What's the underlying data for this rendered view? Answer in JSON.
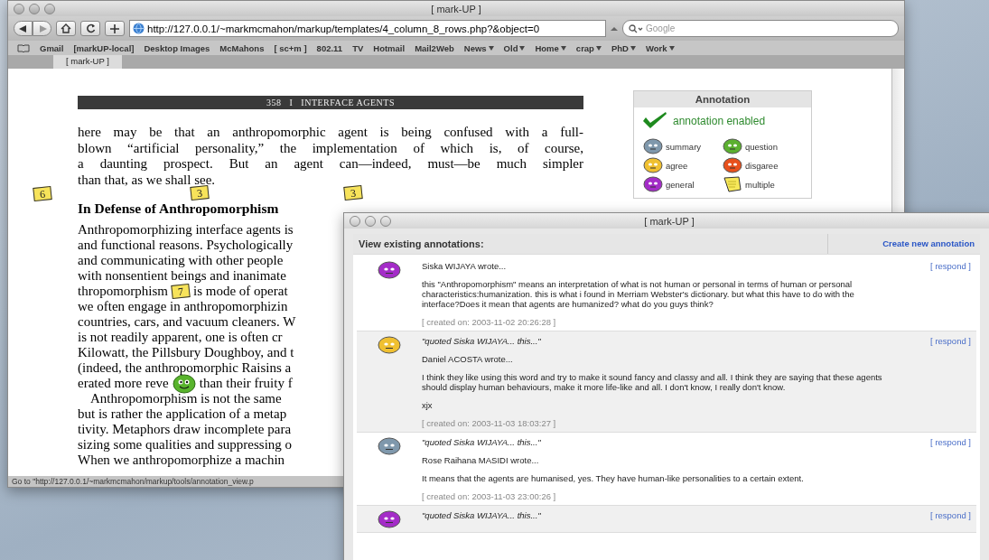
{
  "window": {
    "title": "[ mark-UP ]"
  },
  "toolbar": {
    "url": "http://127.0.0.1/~markmcmahon/markup/templates/4_column_8_rows.php?&object=0",
    "search": {
      "placeholder": "Google"
    }
  },
  "bookmarks": [
    {
      "label": "Gmail",
      "menu": false
    },
    {
      "label": "[markUP-local]",
      "menu": false
    },
    {
      "label": "Desktop Images",
      "menu": false
    },
    {
      "label": "McMahons",
      "menu": false
    },
    {
      "label": "[ sc+m ]",
      "menu": false
    },
    {
      "label": "802.11",
      "menu": false
    },
    {
      "label": "TV",
      "menu": false
    },
    {
      "label": "Hotmail",
      "menu": false
    },
    {
      "label": "Mail2Web",
      "menu": false
    },
    {
      "label": "News",
      "menu": true
    },
    {
      "label": "Old",
      "menu": true
    },
    {
      "label": "Home",
      "menu": true
    },
    {
      "label": "crap",
      "menu": true
    },
    {
      "label": "PhD",
      "menu": true
    },
    {
      "label": "Work",
      "menu": true
    }
  ],
  "tabs": [
    {
      "label": "[ mark-UP ]",
      "selected": true
    }
  ],
  "book": {
    "running_head": "358   I   INTERFACE AGENTS",
    "opening_lines": [
      "here may be that an anthropomorphic agent is being confused with a full-",
      "blown “artificial personality,” the implementation of which is, of course,",
      "a daunting prospect. But an agent can—indeed, must—be much simpler",
      "than that, as we shall see."
    ],
    "notes": [
      {
        "label": "6"
      },
      {
        "label": "3"
      },
      {
        "label": "3"
      }
    ],
    "heading": "In Defense of Anthropomorphism",
    "lines": [
      [
        {
          "kind": "text",
          "text": "Anthropomorphizing interface agents is"
        }
      ],
      [
        {
          "kind": "text",
          "text": "and functional reasons. Psychologically"
        }
      ],
      [
        {
          "kind": "text",
          "text": "and communicating with other people"
        }
      ],
      [
        {
          "kind": "text",
          "text": "with nonsentient beings and inanimate"
        }
      ],
      [
        {
          "kind": "text",
          "text": "thropomorphism"
        },
        {
          "kind": "note",
          "label": "7"
        },
        {
          "kind": "text",
          "text": "is mode of operat"
        }
      ],
      [
        {
          "kind": "text",
          "text": "we often engage in anthropomorphizin"
        }
      ],
      [
        {
          "kind": "text",
          "text": "countries, cars, and vacuum cleaners. W"
        }
      ],
      [
        {
          "kind": "text",
          "text": "is not readily apparent, one is often cr"
        }
      ],
      [
        {
          "kind": "text",
          "text": "Kilowatt, the Pillsbury Doughboy, and t"
        }
      ],
      [
        {
          "kind": "text",
          "text": "(indeed, the anthropomorphic Raisins a"
        }
      ],
      [
        {
          "kind": "text",
          "text": "erated more reve"
        },
        {
          "kind": "face",
          "color": "#58b42c"
        },
        {
          "kind": "text",
          "text": "than their fruity f"
        }
      ],
      [
        {
          "kind": "indent",
          "text": "Anthropomorphism is not the same"
        }
      ],
      [
        {
          "kind": "text",
          "text": "but is rather the application of a metap"
        }
      ],
      [
        {
          "kind": "text",
          "text": "tivity. Metaphors draw incomplete para"
        }
      ],
      [
        {
          "kind": "text",
          "text": "sizing some qualities and suppressing o"
        }
      ],
      [
        {
          "kind": "text",
          "text": "When we anthropomorphize a machin"
        }
      ]
    ]
  },
  "annotation_panel": {
    "title": "Annotation",
    "status": "annotation enabled",
    "enabled": true,
    "legend": [
      {
        "kind": "face",
        "label": "summary",
        "color": "#7f98ac"
      },
      {
        "kind": "face",
        "label": "question",
        "color": "#5cb030"
      },
      {
        "kind": "face",
        "label": "agree",
        "color": "#f0c030"
      },
      {
        "kind": "face",
        "label": "disgaree",
        "color": "#e8501c"
      },
      {
        "kind": "face",
        "label": "general",
        "color": "#a42cc8"
      },
      {
        "kind": "note",
        "label": "multiple"
      }
    ]
  },
  "status_bar": "Go to \"http://127.0.0.1/~markmcmahon/markup/tools/annotation_view.p",
  "popup": {
    "title": "[ mark-UP ]",
    "heading": "View existing annotations:",
    "create_link": "Create new annotation",
    "entries": [
      {
        "color": "#a42cc8",
        "author": "Siska WIJAYA wrote...",
        "body": [
          "this \"Anthropomorphism\" means an interpretation of what is not human or personal in terms of human or personal characteristics:humanization. this is what i found in Merriam Webster's dictionary. but what this have to do with the interface?Does it mean that agents are humanized? what do you guys think?"
        ],
        "created": "[ created on:  2003-11-02 20:26:28 ]",
        "respond": "[ respond ]"
      },
      {
        "color": "#f0c030",
        "quote": "\"quoted Siska WIJAYA... this...\"",
        "author": "Daniel ACOSTA wrote...",
        "body": [
          "I think they like using this word and try to make it sound fancy and classy and all. I think they are saying that these agents should display human behaviours, make it more life-like and all. I don't know, I really don't know.",
          "xjx"
        ],
        "created": "[ created on:  2003-11-03 18:03:27 ]",
        "respond": "[ respond ]"
      },
      {
        "color": "#7f98ac",
        "quote": "\"quoted Siska WIJAYA... this...\"",
        "author": "Rose Raihana MASIDI wrote...",
        "body": [
          "It means that the agents are humanised, yes. They have human-like personalities to a certain extent."
        ],
        "created": "[ created on:  2003-11-03 23:00:26 ]",
        "respond": "[ respond ]"
      },
      {
        "color": "#a42cc8",
        "quote": "\"quoted Siska WIJAYA... this...\"",
        "respond": "[ respond ]"
      }
    ]
  }
}
